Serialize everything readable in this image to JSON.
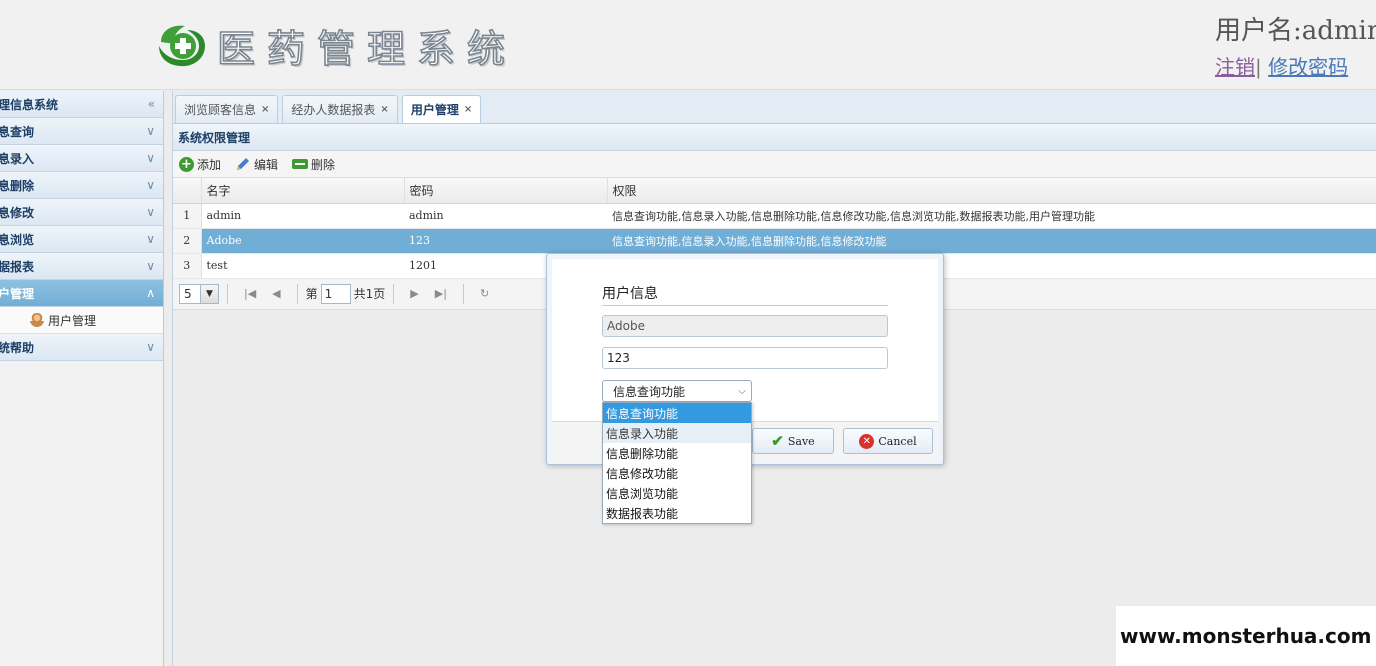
{
  "header": {
    "app_title": "医药管理系统",
    "user_label": "用户名:admin",
    "logout_label": "注销",
    "link_separator": "|",
    "change_password_label": "修改密码"
  },
  "sidebar": {
    "title": "管理信息系统",
    "sections": [
      {
        "label": "信息查询",
        "active": false
      },
      {
        "label": "信息录入",
        "active": false
      },
      {
        "label": "信息删除",
        "active": false
      },
      {
        "label": "信息修改",
        "active": false
      },
      {
        "label": "信息浏览",
        "active": false
      },
      {
        "label": "数据报表",
        "active": false
      },
      {
        "label": "用户管理",
        "active": true
      },
      {
        "label": "系统帮助",
        "active": false
      }
    ],
    "sub_item_label": "用户管理",
    "collapse_glyph": "«",
    "expand_glyph": "»",
    "chevron_down": "∨",
    "chevron_up": "∧"
  },
  "tabs": [
    {
      "label": "浏览顾客信息",
      "active": false
    },
    {
      "label": "经办人数据报表",
      "active": false
    },
    {
      "label": "用户管理",
      "active": true
    }
  ],
  "tab_close_glyph": "×",
  "panel_title": "系统权限管理",
  "toolbar": {
    "add_label": "添加",
    "edit_label": "编辑",
    "delete_label": "删除"
  },
  "table": {
    "columns": [
      "名字",
      "密码",
      "权限"
    ],
    "rows": [
      {
        "num": "1",
        "name": "admin",
        "password": "admin",
        "permissions": "信息查询功能,信息录入功能,信息删除功能,信息修改功能,信息浏览功能,数据报表功能,用户管理功能",
        "selected": false
      },
      {
        "num": "2",
        "name": "Adobe",
        "password": "123",
        "permissions": "信息查询功能,信息录入功能,信息删除功能,信息修改功能",
        "selected": true
      },
      {
        "num": "3",
        "name": "test",
        "password": "1201",
        "permissions": "",
        "selected": false
      }
    ]
  },
  "pager": {
    "page_size": "5",
    "page_prefix": "第",
    "page_number": "1",
    "total_pages": "共1页",
    "first_glyph": "|◀",
    "prev_glyph": "◀",
    "next_glyph": "▶",
    "last_glyph": "▶|",
    "refresh_glyph": "↻"
  },
  "dialog": {
    "heading": "用户信息",
    "name_value": "Adobe",
    "password_value": "123",
    "permission_selected": "信息查询功能",
    "save_label": "Save",
    "cancel_label": "Cancel",
    "dropdown_options": [
      "信息查询功能",
      "信息录入功能",
      "信息删除功能",
      "信息修改功能",
      "信息浏览功能",
      "数据报表功能"
    ]
  },
  "watermark": "www.monsterhua.com",
  "colors": {
    "accent": "#71aed6",
    "dropdown_selected": "#3399e0",
    "add_green": "#3d9a35",
    "cancel_red": "#d8322a"
  }
}
